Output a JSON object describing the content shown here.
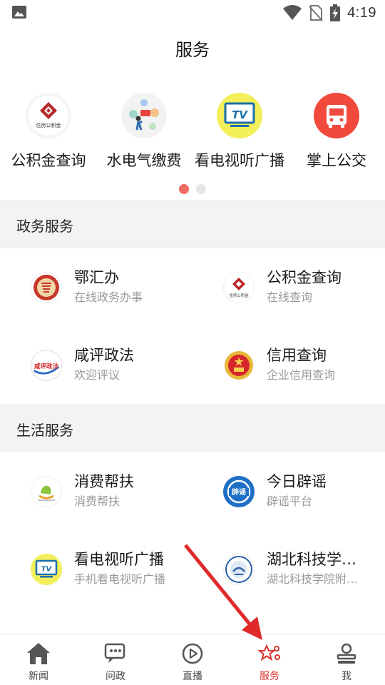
{
  "status_bar": {
    "time": "4:19"
  },
  "page_title": "服务",
  "quick_items": [
    {
      "label": "公积金查询",
      "icon_name": "housing-fund-logo-icon",
      "logo_text": "住房公积金"
    },
    {
      "label": "水电气缴费",
      "icon_name": "utility-payment-icon"
    },
    {
      "label": "看电视听广播",
      "icon_name": "tv-icon",
      "logo_text": "TV"
    },
    {
      "label": "掌上公交",
      "icon_name": "bus-icon"
    }
  ],
  "carousel": {
    "active_page": 1,
    "page_count": 2
  },
  "sections": [
    {
      "title": "政务服务",
      "items": [
        {
          "name": "鄂汇办",
          "sub": "在线政务办事",
          "icon_name": "ehuiban-logo-icon"
        },
        {
          "name": "公积金查询",
          "sub": "在线查询",
          "icon_name": "housing-fund-logo-icon",
          "logo_text": "住房公积金"
        },
        {
          "name": "咸评政法",
          "sub": "欢迎评议",
          "icon_name": "xianping-logo-icon",
          "logo_text": "咸评政法"
        },
        {
          "name": "信用查询",
          "sub": "企业信用查询",
          "icon_name": "national-emblem-icon"
        }
      ]
    },
    {
      "title": "生活服务",
      "items": [
        {
          "name": "消费帮扶",
          "sub": "消费帮扶",
          "icon_name": "consumer-aid-logo-icon"
        },
        {
          "name": "今日辟谣",
          "sub": "辟谣平台",
          "icon_name": "rumor-refute-logo-icon",
          "logo_text": "辟谣"
        },
        {
          "name": "看电视听广播",
          "sub": "手机看电视听广播",
          "icon_name": "tv-icon",
          "logo_text": "TV"
        },
        {
          "name": "湖北科技学…",
          "sub": "湖北科技学院附…",
          "icon_name": "hubei-college-logo-icon"
        }
      ]
    }
  ],
  "bottom_nav": [
    {
      "label": "新闻",
      "icon_name": "home-icon"
    },
    {
      "label": "问政",
      "icon_name": "chat-icon"
    },
    {
      "label": "直播",
      "icon_name": "play-icon"
    },
    {
      "label": "服务",
      "icon_name": "service-star-icon",
      "active": true
    },
    {
      "label": "我",
      "icon_name": "profile-icon"
    }
  ],
  "colors": {
    "accent": "#d9342b",
    "dot_active": "#ee6b68",
    "section_bg": "#f3f3f3",
    "tv_yellow": "#f3ef5a",
    "bus_red": "#f14a3d"
  }
}
